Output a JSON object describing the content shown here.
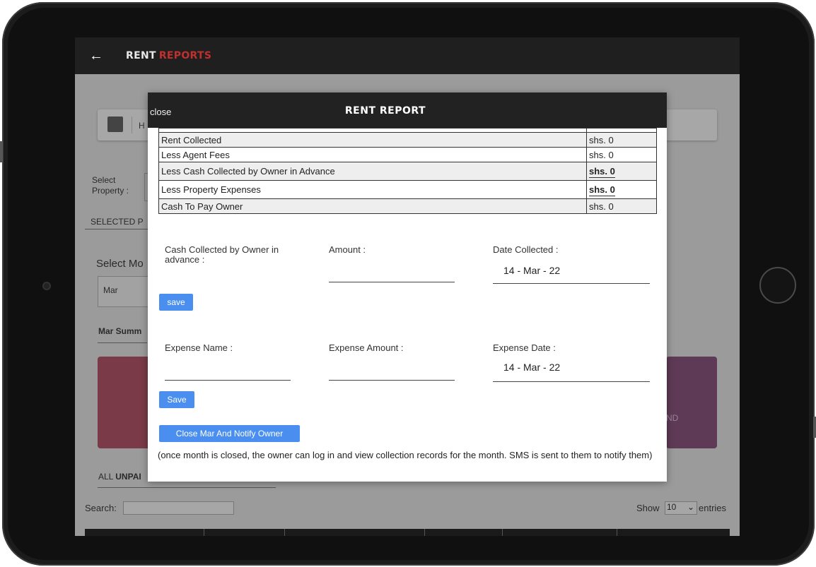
{
  "app_bar": {
    "back": "←",
    "title_part1": "RENT",
    "title_part2": "REPORTS"
  },
  "background": {
    "select_property_label_1": "Select",
    "select_property_label_2": "Property :",
    "selected_property": "SELECTED P",
    "select_month": "Select Mo",
    "month_value": "Mar",
    "summary_heading": "Mar Summ",
    "tile_right_text": "ND",
    "all_unpaid_prefix": "ALL",
    "all_unpaid_bold": "UNPAI",
    "search_label": "Search:",
    "show_label": "Show",
    "show_value": "10",
    "entries_label": "entries"
  },
  "modal": {
    "close_label": "close",
    "title": "RENT REPORT",
    "report_rows": [
      {
        "label": "Rent Collected",
        "value": "shs. 0",
        "bold": false
      },
      {
        "label": "Less Agent Fees",
        "value": "shs. 0",
        "bold": false
      },
      {
        "label": "Less Cash Collected by Owner in Advance",
        "value": "shs. 0",
        "bold": true
      },
      {
        "label": "Less Property Expenses",
        "value": "shs. 0",
        "bold": true
      },
      {
        "label": "Cash To Pay Owner",
        "value": "shs. 0",
        "bold": false
      }
    ],
    "advance_form": {
      "label": "Cash Collected by Owner in advance :",
      "amount_label": "Amount :",
      "amount_value": "",
      "date_label": "Date Collected :",
      "date_value": "14 - Mar - 22",
      "save_label": "save"
    },
    "expense_form": {
      "name_label": "Expense Name :",
      "name_value": "",
      "amount_label": "Expense Amount :",
      "amount_value": "",
      "date_label": "Expense Date :",
      "date_value": "14 - Mar - 22",
      "save_label": "Save"
    },
    "close_month_button": "Close Mar And Notify Owner",
    "note": "(once month is closed, the owner can log in and view collection records for the month. SMS is sent to them to notify them)"
  }
}
